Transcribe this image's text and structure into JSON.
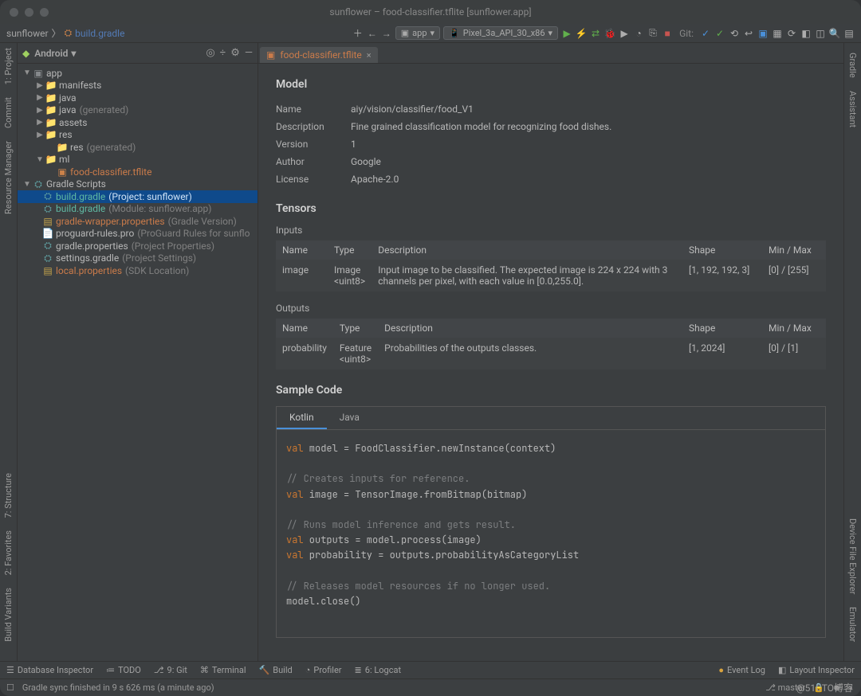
{
  "titlebar": {
    "title": "sunflower – food-classifier.tflite [sunflower.app]"
  },
  "breadcrumb": {
    "project": "sunflower",
    "file_icon": "gradle",
    "file": "build.gradle"
  },
  "toolbar": {
    "run_config_1": "app",
    "run_config_2": "Pixel_3a_API_30_x86",
    "git_label": "Git:"
  },
  "project_panel": {
    "title": "Android"
  },
  "tree": {
    "app": "app",
    "manifests": "manifests",
    "java": "java",
    "java_gen": "java",
    "java_gen_sub": "(generated)",
    "assets": "assets",
    "res": "res",
    "res_gen": "res",
    "res_gen_sub": "(generated)",
    "ml": "ml",
    "tflite": "food-classifier.tflite",
    "gradle_scripts": "Gradle Scripts",
    "build_gradle_proj": "build.gradle",
    "build_gradle_proj_sub": "(Project: sunflower)",
    "build_gradle_mod": "build.gradle",
    "build_gradle_mod_sub": "(Module: sunflower.app)",
    "wrapper": "gradle-wrapper.properties",
    "wrapper_sub": "(Gradle Version)",
    "proguard": "proguard-rules.pro",
    "proguard_sub": "(ProGuard Rules for sunflo",
    "gradle_props": "gradle.properties",
    "gradle_props_sub": "(Project Properties)",
    "settings": "settings.gradle",
    "settings_sub": "(Project Settings)",
    "local": "local.properties",
    "local_sub": "(SDK Location)"
  },
  "tab": {
    "name": "food-classifier.tflite"
  },
  "model": {
    "heading": "Model",
    "rows": {
      "name_k": "Name",
      "name_v": "aiy/vision/classifier/food_V1",
      "desc_k": "Description",
      "desc_v": "Fine grained classification model for recognizing food dishes.",
      "ver_k": "Version",
      "ver_v": "1",
      "auth_k": "Author",
      "auth_v": "Google",
      "lic_k": "License",
      "lic_v": "Apache-2.0"
    }
  },
  "tensors": {
    "heading": "Tensors",
    "inputs_label": "Inputs",
    "outputs_label": "Outputs",
    "th": {
      "name": "Name",
      "type": "Type",
      "desc": "Description",
      "shape": "Shape",
      "mm": "Min / Max"
    },
    "in": {
      "name": "image",
      "type": "Image <uint8>",
      "desc": "Input image to be classified. The expected image is 224 x 224 with 3 channels per pixel, with each value in [0.0,255.0].",
      "shape": "[1, 192, 192, 3]",
      "mm": "[0] / [255]"
    },
    "out": {
      "name": "probability",
      "type": "Feature <uint8>",
      "desc": "Probabilities of the outputs classes.",
      "shape": "[1, 2024]",
      "mm": "[0] / [1]"
    }
  },
  "sample": {
    "heading": "Sample Code",
    "tab_kotlin": "Kotlin",
    "tab_java": "Java",
    "l1_kw": "val",
    "l1": " model = FoodClassifier.newInstance(context)",
    "c1": "// Creates inputs for reference.",
    "l2_kw": "val",
    "l2": " image = TensorImage.fromBitmap(bitmap)",
    "c2": "// Runs model inference and gets result.",
    "l3_kw": "val",
    "l3": " outputs = model.process(image)",
    "l4_kw": "val",
    "l4": " probability = outputs.probabilityAsCategoryList",
    "c3": "// Releases model resources if no longer used.",
    "l5": "model.close()"
  },
  "left_rail": {
    "project": "1: Project",
    "commit": "Commit",
    "rm": "Resource Manager",
    "structure": "7: Structure",
    "fav": "2: Favorites",
    "build_var": "Build Variants"
  },
  "right_rail": {
    "gradle": "Gradle",
    "assistant": "Assistant",
    "dfe": "Device File Explorer",
    "emulator": "Emulator"
  },
  "bottom": {
    "db": "Database Inspector",
    "todo": "TODO",
    "git": "9: Git",
    "terminal": "Terminal",
    "build": "Build",
    "profiler": "Profiler",
    "logcat": "6: Logcat",
    "event_log": "Event Log",
    "layout": "Layout Inspector"
  },
  "status": {
    "msg": "Gradle sync finished in 9 s 626 ms (a minute ago)",
    "branch": "master"
  },
  "watermark": "@51CTO博客"
}
